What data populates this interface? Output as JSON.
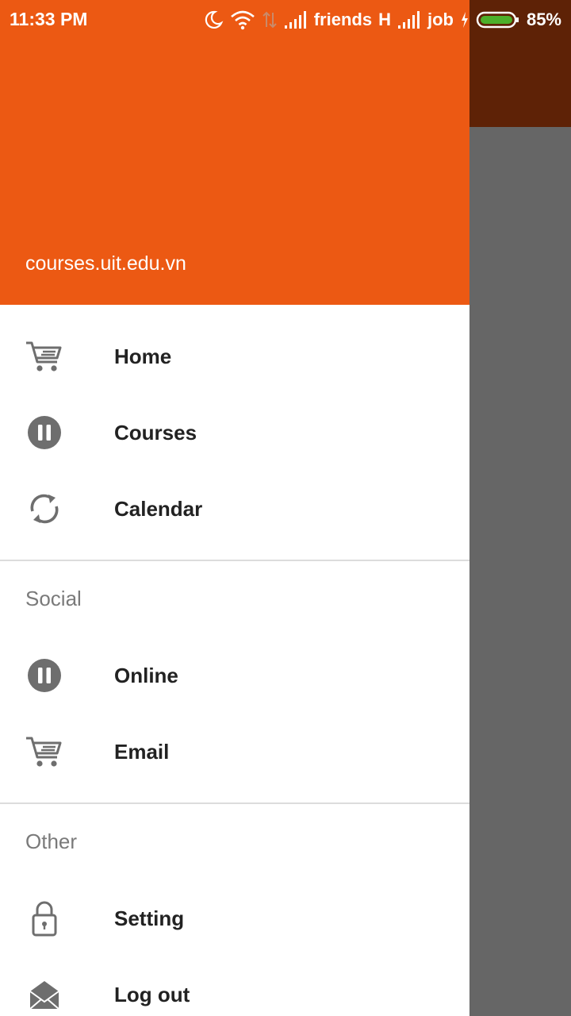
{
  "status_bar": {
    "time": "11:33 PM",
    "carrier1": "friends",
    "net_type": "H",
    "carrier2": "job",
    "battery": "85%",
    "battery_level": 0.85,
    "icons": [
      "moon-icon",
      "wifi-icon",
      "data-arrows-icon",
      "signal-icon",
      "signal-icon",
      "charging-icon",
      "battery-icon"
    ]
  },
  "header": {
    "url": "courses.uit.edu.vn",
    "color": "#ec5913"
  },
  "menu": {
    "main": [
      {
        "label": "Home",
        "icon": "cart-icon"
      },
      {
        "label": "Courses",
        "icon": "pause-circle-icon"
      },
      {
        "label": "Calendar",
        "icon": "sync-icon"
      }
    ],
    "social": {
      "title": "Social",
      "items": [
        {
          "label": "Online",
          "icon": "pause-circle-icon"
        },
        {
          "label": "Email",
          "icon": "cart-icon"
        }
      ]
    },
    "other": {
      "title": "Other",
      "items": [
        {
          "label": "Setting",
          "icon": "lock-icon"
        },
        {
          "label": "Log out",
          "icon": "envelope-icon"
        }
      ]
    }
  }
}
